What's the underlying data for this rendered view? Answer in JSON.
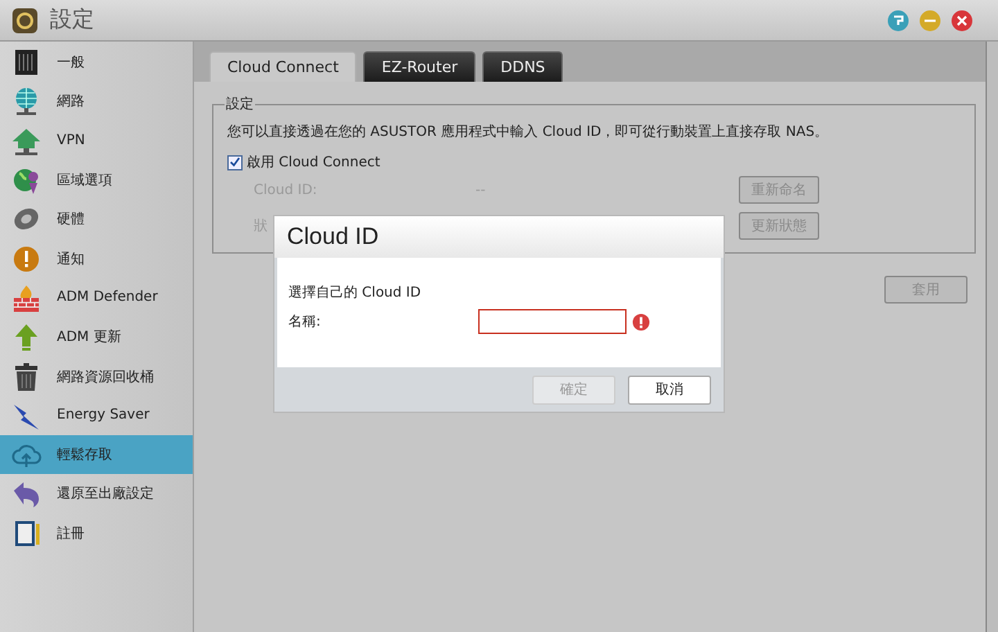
{
  "window": {
    "title": "設定"
  },
  "sidebar": {
    "items": [
      {
        "label": "一般",
        "selected": false
      },
      {
        "label": "網路",
        "selected": false
      },
      {
        "label": "VPN",
        "selected": false
      },
      {
        "label": "區域選項",
        "selected": false
      },
      {
        "label": "硬體",
        "selected": false
      },
      {
        "label": "通知",
        "selected": false
      },
      {
        "label": "ADM Defender",
        "selected": false
      },
      {
        "label": "ADM 更新",
        "selected": false
      },
      {
        "label": "網路資源回收桶",
        "selected": false
      },
      {
        "label": "Energy Saver",
        "selected": false
      },
      {
        "label": "輕鬆存取",
        "selected": true
      },
      {
        "label": "還原至出廠設定",
        "selected": false
      },
      {
        "label": "註冊",
        "selected": false
      }
    ]
  },
  "tabs": [
    {
      "label": "Cloud Connect",
      "selected": true
    },
    {
      "label": "EZ-Router",
      "selected": false
    },
    {
      "label": "DDNS",
      "selected": false
    }
  ],
  "settings": {
    "legend": "設定",
    "description": "您可以直接透過在您的 ASUSTOR 應用程式中輸入 Cloud ID，即可從行動裝置上直接存取 NAS。",
    "enable": {
      "label": "啟用 Cloud Connect",
      "checked": true
    },
    "rows": [
      {
        "label": "Cloud ID:",
        "value": "--",
        "button": {
          "label": "重新命名",
          "disabled": true
        }
      },
      {
        "label": "狀",
        "button": {
          "label": "更新狀態",
          "disabled": true
        }
      }
    ],
    "apply_button": {
      "label": "套用",
      "disabled": true
    }
  },
  "dialog": {
    "title": "Cloud ID",
    "prompt": "選擇自己的 Cloud ID",
    "field": {
      "label": "名稱:",
      "error": true
    },
    "buttons": [
      {
        "label": "確定",
        "disabled": true
      },
      {
        "label": "取消",
        "disabled": false
      }
    ]
  }
}
